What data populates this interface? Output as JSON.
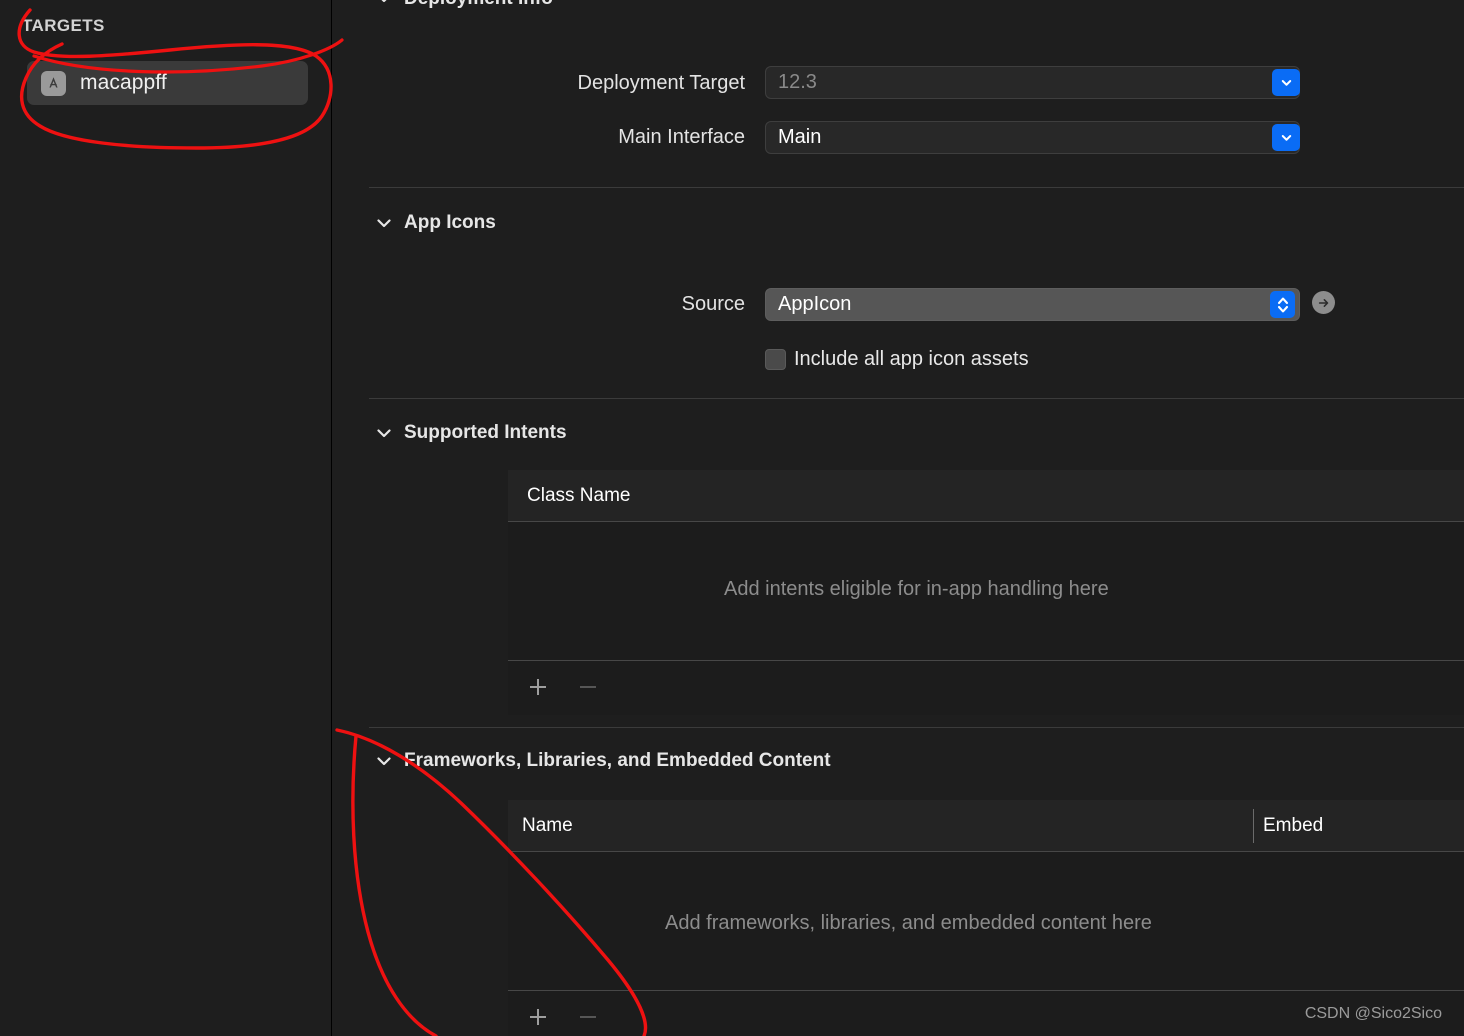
{
  "sidebar": {
    "header": "TARGETS",
    "targets": [
      {
        "name": "macappff",
        "icon": "app-store-icon"
      }
    ]
  },
  "main": {
    "sections": [
      {
        "id": "deployment-info",
        "title": "Deployment Info",
        "expanded": true,
        "fields": [
          {
            "label": "Deployment Target",
            "value": "12.3",
            "style": "placeholder",
            "control": "chevron-down-button"
          },
          {
            "label": "Main Interface",
            "value": "Main",
            "style": "value",
            "control": "chevron-down-button"
          }
        ]
      },
      {
        "id": "app-icons",
        "title": "App Icons",
        "expanded": true,
        "source_label": "Source",
        "source_value": "AppIcon",
        "source_control": "up-down-stepper",
        "reveal_control": "arrow-right-circle-icon",
        "checkbox_label": "Include all app icon assets",
        "checkbox_checked": false
      },
      {
        "id": "supported-intents",
        "title": "Supported Intents",
        "expanded": true,
        "columns": [
          "Class Name"
        ],
        "rows": [],
        "empty_message": "Add intents eligible for in-app handling here",
        "add_label": "+",
        "remove_label": "–"
      },
      {
        "id": "frameworks-libraries",
        "title": "Frameworks, Libraries, and Embedded Content",
        "expanded": true,
        "columns": [
          "Name",
          "Embed"
        ],
        "rows": [],
        "empty_message": "Add frameworks, libraries, and embedded content here",
        "add_label": "+",
        "remove_label": "–"
      }
    ]
  },
  "watermark": "CSDN @Sico2Sico",
  "colors": {
    "accent_blue": "#0a6cf5",
    "annotation_red": "#ee1111",
    "panel_bg": "#1e1e1e",
    "row_selected": "#3a3a3a",
    "popup_bg": "#565656"
  }
}
